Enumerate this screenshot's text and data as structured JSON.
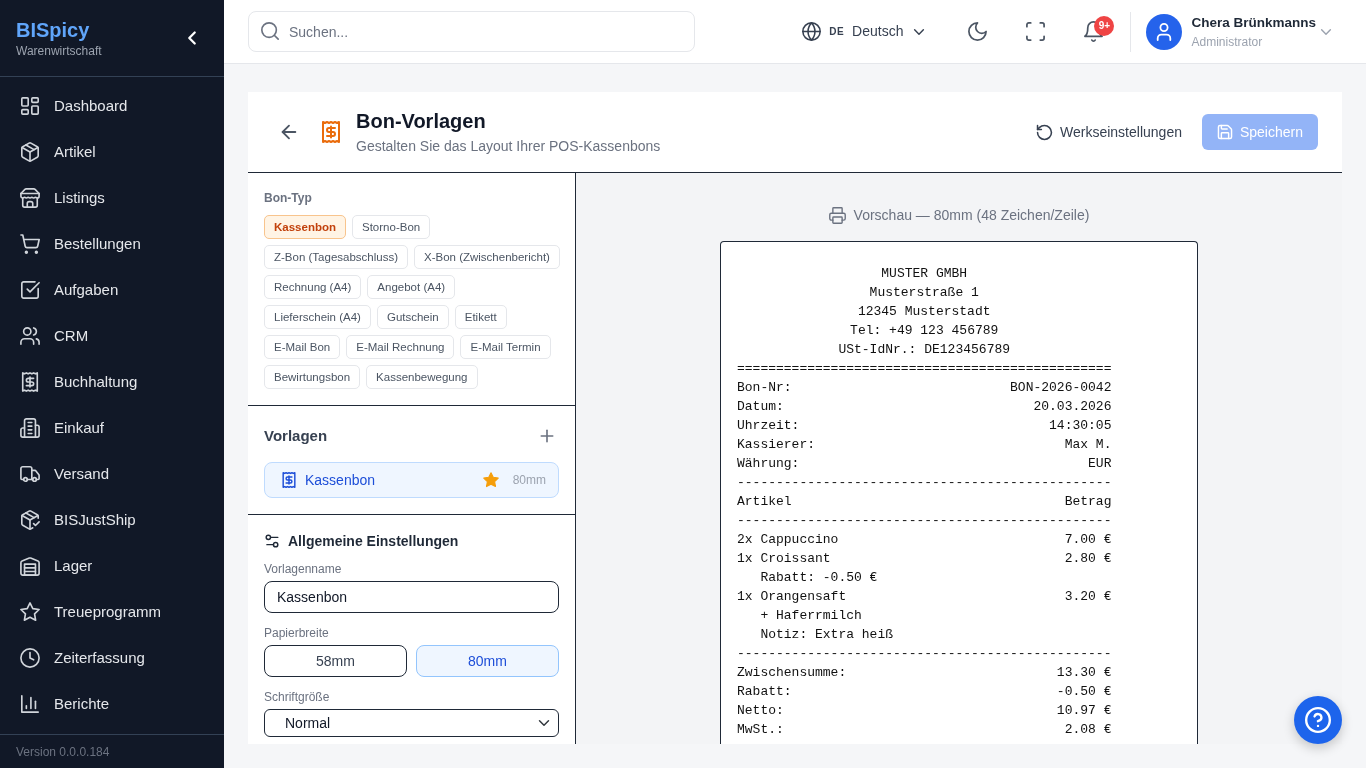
{
  "sidebar": {
    "brand": "BISpicy",
    "subtitle": "Warenwirtschaft",
    "items": [
      "Dashboard",
      "Artikel",
      "Listings",
      "Bestellungen",
      "Aufgaben",
      "CRM",
      "Buchhaltung",
      "Einkauf",
      "Versand",
      "BISJustShip",
      "Lager",
      "Treueprogramm",
      "Zeiterfassung",
      "Berichte"
    ],
    "version": "Version 0.0.0.184"
  },
  "topbar": {
    "search": {
      "placeholder": "Suchen..."
    },
    "language": {
      "code": "DE",
      "label": "Deutsch"
    },
    "notifications": {
      "badge": "9+"
    },
    "user": {
      "name": "Chera Brünkmanns",
      "role": "Administrator"
    }
  },
  "header": {
    "title": "Bon-Vorlagen",
    "subtitle": "Gestalten Sie das Layout Ihrer POS-Kassenbons",
    "buttons": [
      {
        "kind": "reset",
        "label": "Werkseinstellungen",
        "disabled": false
      },
      {
        "kind": "save",
        "label": "Speichern",
        "disabled": true
      }
    ]
  },
  "bon_types": {
    "label": "Bon-Typ",
    "chips": [
      {
        "label": "Kassenbon",
        "selected": true
      },
      {
        "label": "Storno-Bon",
        "selected": false
      },
      {
        "label": "Z-Bon (Tagesabschluss)",
        "selected": false
      },
      {
        "label": "X-Bon (Zwischenbericht)",
        "selected": false
      },
      {
        "label": "Rechnung (A4)",
        "selected": false
      },
      {
        "label": "Angebot (A4)",
        "selected": false
      },
      {
        "label": "Lieferschein (A4)",
        "selected": false
      },
      {
        "label": "Gutschein",
        "selected": false
      },
      {
        "label": "Etikett",
        "selected": false
      },
      {
        "label": "E-Mail Bon",
        "selected": false
      },
      {
        "label": "E-Mail Rechnung",
        "selected": false
      },
      {
        "label": "E-Mail Termin",
        "selected": false
      },
      {
        "label": "Bewirtungsbon",
        "selected": false
      },
      {
        "label": "Kassenbewegung",
        "selected": false
      }
    ]
  },
  "templates": {
    "title": "Vorlagen",
    "items": [
      {
        "name": "Kassenbon",
        "width": "80mm",
        "favorite": true,
        "selected": true
      }
    ]
  },
  "settings": {
    "title": "Allgemeine Einstellungen",
    "fields": [
      {
        "kind": "text",
        "label": "Vorlagenname",
        "value": "Kassenbon"
      },
      {
        "kind": "segmented",
        "label": "Papierbreite",
        "options": [
          {
            "label": "58mm",
            "selected": false
          },
          {
            "label": "80mm",
            "selected": true
          }
        ]
      },
      {
        "kind": "select",
        "label": "Schriftgröße",
        "value": "Normal"
      }
    ]
  },
  "preview": {
    "caption": "Vorschau — 80mm (48 Zeichen/Zeile)",
    "lines": [
      {
        "kind": "center",
        "text": "MUSTER GMBH"
      },
      {
        "kind": "center",
        "text": "Musterstraße 1"
      },
      {
        "kind": "center",
        "text": "12345 Musterstadt"
      },
      {
        "kind": "center",
        "text": "Tel: +49 123 456789"
      },
      {
        "kind": "center",
        "text": "USt-IdNr.: DE123456789"
      },
      {
        "kind": "rule",
        "text": "================================================"
      },
      {
        "kind": "pair",
        "label": "Bon-Nr:",
        "value": "BON-2026-0042"
      },
      {
        "kind": "pair",
        "label": "Datum:",
        "value": "20.03.2026"
      },
      {
        "kind": "pair",
        "label": "Uhrzeit:",
        "value": "14:30:05"
      },
      {
        "kind": "pair",
        "label": "Kassierer:",
        "value": "Max M."
      },
      {
        "kind": "pair",
        "label": "Währung:",
        "value": "EUR"
      },
      {
        "kind": "rule",
        "text": "------------------------------------------------"
      },
      {
        "kind": "pair",
        "label": "Artikel",
        "value": "Betrag"
      },
      {
        "kind": "rule",
        "text": "------------------------------------------------"
      },
      {
        "kind": "pair",
        "label": "2x Cappuccino",
        "value": "7.00 €"
      },
      {
        "kind": "pair",
        "label": "1x Croissant",
        "value": "2.80 €"
      },
      {
        "kind": "note",
        "text": "Rabatt: -0.50 €"
      },
      {
        "kind": "pair",
        "label": "1x Orangensaft",
        "value": "3.20 €"
      },
      {
        "kind": "note",
        "text": "+ Haferrmilch"
      },
      {
        "kind": "note",
        "text": "Notiz: Extra heiß"
      },
      {
        "kind": "rule",
        "text": "------------------------------------------------"
      },
      {
        "kind": "pair",
        "label": "Zwischensumme:",
        "value": "13.30 €"
      },
      {
        "kind": "pair",
        "label": "Rabatt:",
        "value": "-0.50 €"
      },
      {
        "kind": "pair",
        "label": "Netto:",
        "value": "10.97 €"
      },
      {
        "kind": "pair",
        "label": "MwSt.:",
        "value": "2.08 €"
      }
    ]
  }
}
